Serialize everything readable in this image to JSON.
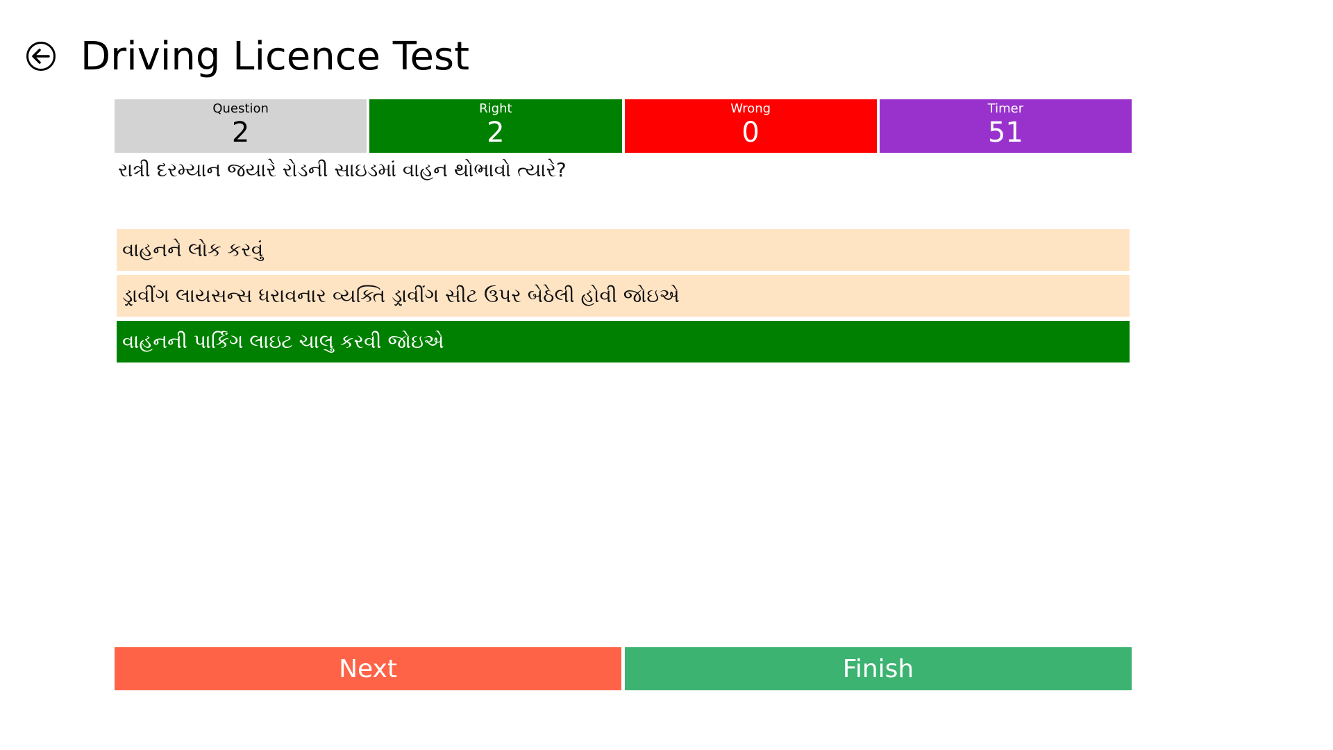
{
  "header": {
    "title": "Driving Licence Test",
    "back_icon": "arrow-left-circle-icon"
  },
  "stats": {
    "question": {
      "label": "Question",
      "value": "2",
      "color": "#d3d3d3"
    },
    "right": {
      "label": "Right",
      "value": "2",
      "color": "#008000"
    },
    "wrong": {
      "label": "Wrong",
      "value": "0",
      "color": "#ff0000"
    },
    "timer": {
      "label": "Timer",
      "value": "51",
      "color": "#9932cc"
    }
  },
  "question": {
    "text": "રાત્રી દરમ્યાન જયારે રોડની સાઇડમાં વાહન થોભાવો ત્યારે?"
  },
  "options": [
    {
      "text": "વાહનને લોક કરવું",
      "state": "default",
      "color": "#ffe4c4"
    },
    {
      "text": "ડ્રાવીંગ લાયસન્સ ધરાવનાર વ્યક્તિ ડ્રાવીંગ સીટ ઉપર બેઠેલી હોવી જોઇએ",
      "state": "default",
      "color": "#ffe4c4"
    },
    {
      "text": "વાહનની પાર્કિંગ લાઇટ ચાલુ કરવી જોઇએ",
      "state": "correct",
      "color": "#008000"
    }
  ],
  "actions": {
    "next_label": "Next",
    "finish_label": "Finish",
    "next_color": "#ff6347",
    "finish_color": "#3cb371"
  }
}
